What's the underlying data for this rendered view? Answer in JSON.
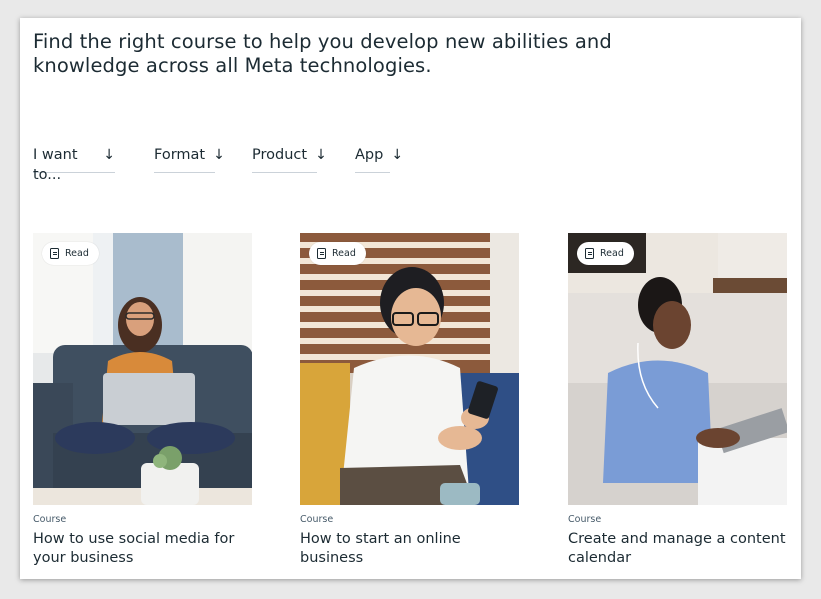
{
  "headline": "Find the right course to help you develop new abilities and knowledge across all Meta technologies.",
  "filters": [
    {
      "label": "I want to...",
      "icon": "arrow-down-icon"
    },
    {
      "label": "Format",
      "icon": "arrow-down-icon"
    },
    {
      "label": "Product",
      "icon": "arrow-down-icon"
    },
    {
      "label": "App",
      "icon": "arrow-down-icon"
    }
  ],
  "cards": [
    {
      "badge": "Read",
      "kind": "Course",
      "title": "How to use social media for your business"
    },
    {
      "badge": "Read",
      "kind": "Course",
      "title": "How to start an online business"
    },
    {
      "badge": "Read",
      "kind": "Course",
      "title": "Create and manage a content calendar"
    }
  ],
  "colors": {
    "text": "#1c2b33",
    "muted": "#465a69",
    "divider": "#cbd2d9",
    "background": "#ffffff"
  }
}
